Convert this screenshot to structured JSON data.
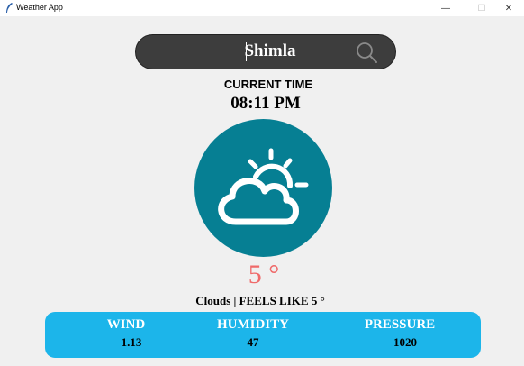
{
  "window": {
    "title": "Weather App",
    "minimize": "—",
    "maximize": "☐",
    "close": "✕"
  },
  "search": {
    "value": "Shimla",
    "icon": "search-icon"
  },
  "time": {
    "label": "CURRENT TIME",
    "value": "08:11 PM"
  },
  "weather": {
    "icon": "partly-cloudy-icon",
    "circle_color": "#067f93",
    "temperature": "5 °",
    "temperature_color": "#ef6a6a",
    "condition_line": "Clouds | FEELS LIKE 5 °"
  },
  "stats": {
    "panel_color": "#1cb5ea",
    "wind": {
      "label": "WIND",
      "value": "1.13"
    },
    "humidity": {
      "label": "HUMIDITY",
      "value": "47"
    },
    "pressure": {
      "label": "PRESSURE",
      "value": "1020"
    }
  }
}
